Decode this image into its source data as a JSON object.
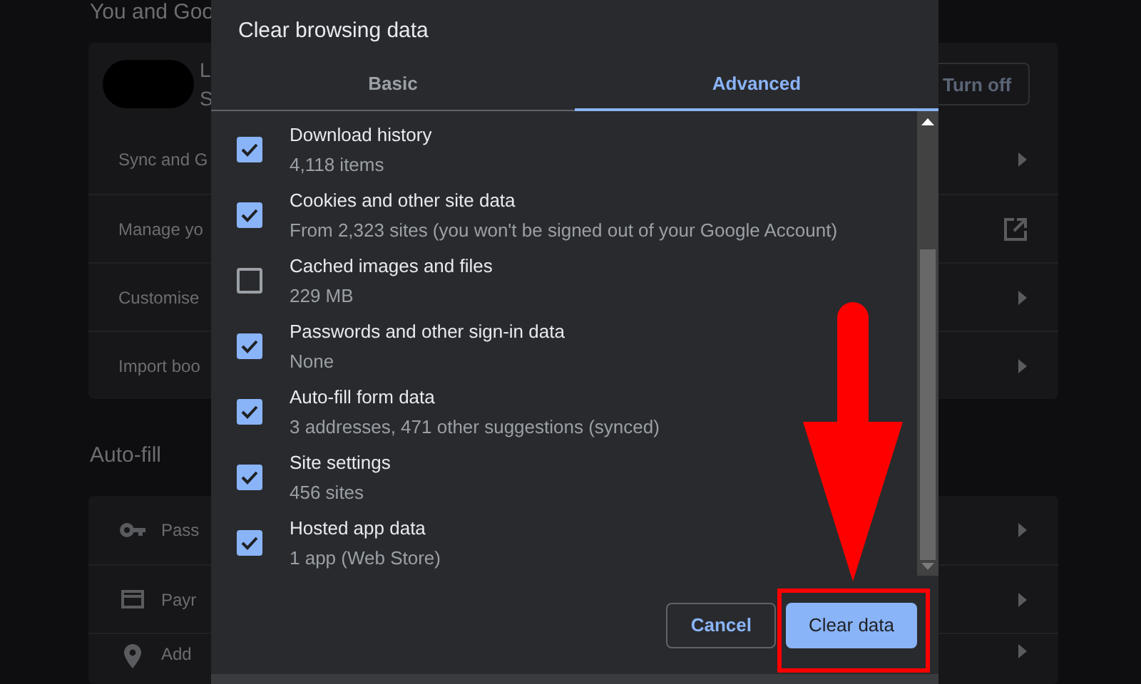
{
  "background": {
    "heading": "You and Goo",
    "account": {
      "name": "L",
      "status": "S",
      "button": "Turn off"
    },
    "account_rows": [
      {
        "label": "Sync and G",
        "kind": "submenu"
      },
      {
        "label": "Manage yo",
        "kind": "link"
      },
      {
        "label": "Customise",
        "kind": "submenu"
      },
      {
        "label": "Import boo",
        "kind": "submenu"
      }
    ],
    "autofill_heading": "Auto-fill",
    "autofill_rows": [
      {
        "label": "Pass"
      },
      {
        "label": "Payr"
      },
      {
        "label": "Add"
      }
    ]
  },
  "dialog": {
    "title": "Clear browsing data",
    "tabs": [
      {
        "label": "Basic",
        "selected": false
      },
      {
        "label": "Advanced",
        "selected": true
      }
    ],
    "items": [
      {
        "title": "Download history",
        "detail": "4,118 items",
        "checked": true
      },
      {
        "title": "Cookies and other site data",
        "detail": "From 2,323 sites (you won't be signed out of your Google Account)",
        "checked": true
      },
      {
        "title": "Cached images and files",
        "detail": "229 MB",
        "checked": false
      },
      {
        "title": "Passwords and other sign-in data",
        "detail": "None",
        "checked": true
      },
      {
        "title": "Auto-fill form data",
        "detail": "3 addresses, 471 other suggestions (synced)",
        "checked": true
      },
      {
        "title": "Site settings",
        "detail": "456 sites",
        "checked": true
      },
      {
        "title": "Hosted app data",
        "detail": "1 app (Web Store)",
        "checked": true
      }
    ],
    "buttons": [
      {
        "label": "Cancel",
        "kind": "secondary"
      },
      {
        "label": "Clear data",
        "kind": "primary"
      }
    ]
  }
}
